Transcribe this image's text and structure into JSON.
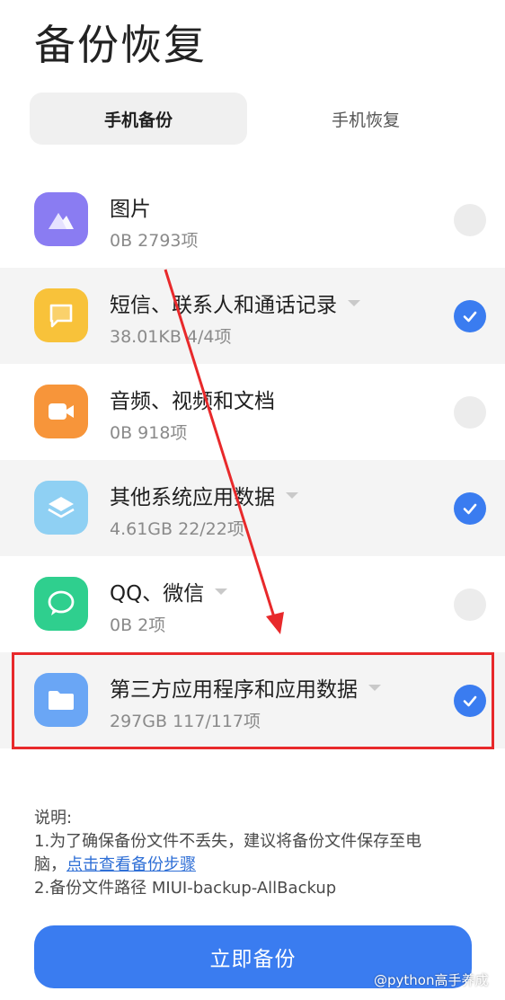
{
  "header": {
    "title": "备份恢复"
  },
  "tabs": [
    {
      "label": "手机备份",
      "active": true
    },
    {
      "label": "手机恢复",
      "active": false
    }
  ],
  "items": [
    {
      "title": "图片",
      "subtitle": "0B  2793项",
      "has_dropdown": false,
      "checked": false,
      "icon": "image-icon",
      "color": "#8a7cf2"
    },
    {
      "title": "短信、联系人和通话记录",
      "subtitle": "38.01KB  4/4项",
      "has_dropdown": true,
      "checked": true,
      "icon": "message-icon",
      "color": "#f8c23a"
    },
    {
      "title": "音频、视频和文档",
      "subtitle": "0B  918项",
      "has_dropdown": false,
      "checked": false,
      "icon": "video-icon",
      "color": "#f7953a"
    },
    {
      "title": "其他系统应用数据",
      "subtitle": "4.61GB  22/22项",
      "has_dropdown": true,
      "checked": true,
      "icon": "layers-icon",
      "color": "#8fd0f3"
    },
    {
      "title": "QQ、微信",
      "subtitle": "0B  2项",
      "has_dropdown": true,
      "checked": false,
      "icon": "chat-icon",
      "color": "#2fcf8e"
    },
    {
      "title": "第三方应用程序和应用数据",
      "subtitle": "297GB  117/117项",
      "has_dropdown": true,
      "checked": true,
      "icon": "folder-icon",
      "color": "#6aa6f5"
    }
  ],
  "notes": {
    "heading": "说明:",
    "line1": "1.为了确保备份文件不丢失，建议将备份文件保存至电",
    "line1b": "脑，",
    "link": "点击查看备份步骤",
    "line2": "2.备份文件路径 MIUI-backup-AllBackup"
  },
  "action": {
    "label": "立即备份"
  },
  "watermark": "@python高手养成",
  "colors": {
    "accent": "#3a7cf0",
    "annotation": "#e8292b"
  }
}
